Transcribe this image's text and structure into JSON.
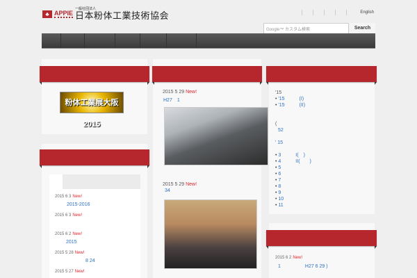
{
  "header": {
    "logo_mark": "♣",
    "logo_appie": "APPIE",
    "logo_sub": "一般社団法人",
    "logo_main": "日本粉体工業技術協会",
    "english_link": "English",
    "search_placeholder": "Google™ カスタム検索",
    "search_button": "Search"
  },
  "left": {
    "banner_text": "粉体工業展大阪 2015",
    "news": [
      {
        "date": "2015 6 3",
        "new": "New!",
        "title": "2015-2016"
      },
      {
        "date": "2015 6 3",
        "new": "New!",
        "title": ""
      },
      {
        "date": "2015 6 2",
        "new": "New!",
        "title": "2015"
      },
      {
        "date": "2015 5 28",
        "new": "New!",
        "title": "8 24"
      },
      {
        "date": "2015 5 27",
        "new": "New!",
        "title": ""
      }
    ]
  },
  "middle": {
    "posts": [
      {
        "date": "2015 5 29",
        "new": "New!",
        "title": "H27　1"
      },
      {
        "date": "2015 5 29",
        "new": "New!",
        "title": "34"
      }
    ]
  },
  "right": {
    "heading1": "'15",
    "items1": [
      "'15　　　(I)",
      "'15　　　(II)"
    ],
    "paren": "(",
    "num52": "52",
    "heading2": "' 15",
    "items2": [
      "3　　　I(　)",
      "4　　　II(　　)",
      "5",
      "6",
      "7",
      "8",
      "9",
      "10",
      "11"
    ],
    "news": {
      "date": "2015 6 2",
      "new": "New!",
      "title": "1　　　　　H27 6 29 )"
    }
  }
}
